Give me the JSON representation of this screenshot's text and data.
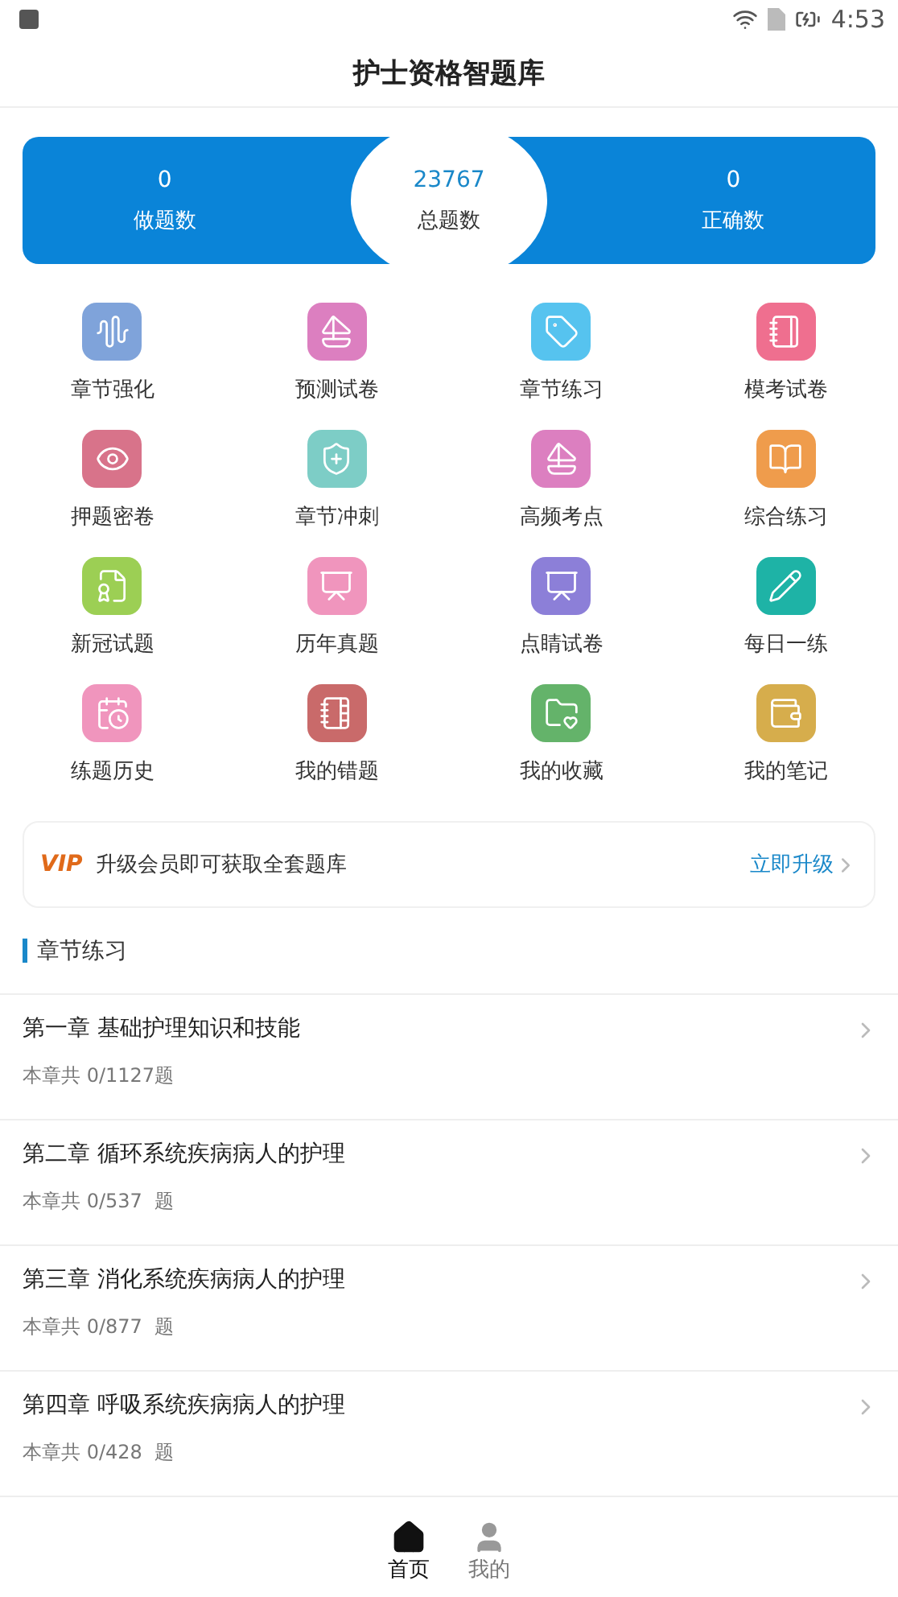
{
  "status_bar": {
    "time": "4:53"
  },
  "title": "护士资格智题库",
  "stats": [
    {
      "value": "0",
      "label": "做题数"
    },
    {
      "value": "23767",
      "label": "总题数"
    },
    {
      "value": "0",
      "label": "正确数"
    }
  ],
  "features": [
    {
      "label": "章节强化",
      "color": "#7fa3da"
    },
    {
      "label": "预测试卷",
      "color": "#dc7fc0"
    },
    {
      "label": "章节练习",
      "color": "#56c3ef"
    },
    {
      "label": "模考试卷",
      "color": "#ef6f8f"
    },
    {
      "label": "押题密卷",
      "color": "#d8738a"
    },
    {
      "label": "章节冲刺",
      "color": "#7dcdc6"
    },
    {
      "label": "高频考点",
      "color": "#dc7fc0"
    },
    {
      "label": "综合练习",
      "color": "#ef9c4c"
    },
    {
      "label": "新冠试题",
      "color": "#9ccf54"
    },
    {
      "label": "历年真题",
      "color": "#f095bd"
    },
    {
      "label": "点睛试卷",
      "color": "#8c7fd8"
    },
    {
      "label": "每日一练",
      "color": "#1eb3a6"
    },
    {
      "label": "练题历史",
      "color": "#f095bd"
    },
    {
      "label": "我的错题",
      "color": "#c96a6a"
    },
    {
      "label": "我的收藏",
      "color": "#64b36a"
    },
    {
      "label": "我的笔记",
      "color": "#d6ad4c"
    }
  ],
  "vip": {
    "badge": "VIP",
    "text": "升级会员即可获取全套题库",
    "action": "立即升级"
  },
  "section": "章节练习",
  "chapters": [
    {
      "title": "第一章 基础护理知识和技能",
      "count": "本章共 0/1127题"
    },
    {
      "title": "第二章 循环系统疾病病人的护理",
      "count": "本章共 0/537  题"
    },
    {
      "title": "第三章 消化系统疾病病人的护理",
      "count": "本章共 0/877  题"
    },
    {
      "title": "第四章 呼吸系统疾病病人的护理",
      "count": "本章共 0/428  题"
    }
  ],
  "tabs": [
    {
      "label": "首页",
      "selected": true
    },
    {
      "label": "我的",
      "selected": false
    }
  ]
}
